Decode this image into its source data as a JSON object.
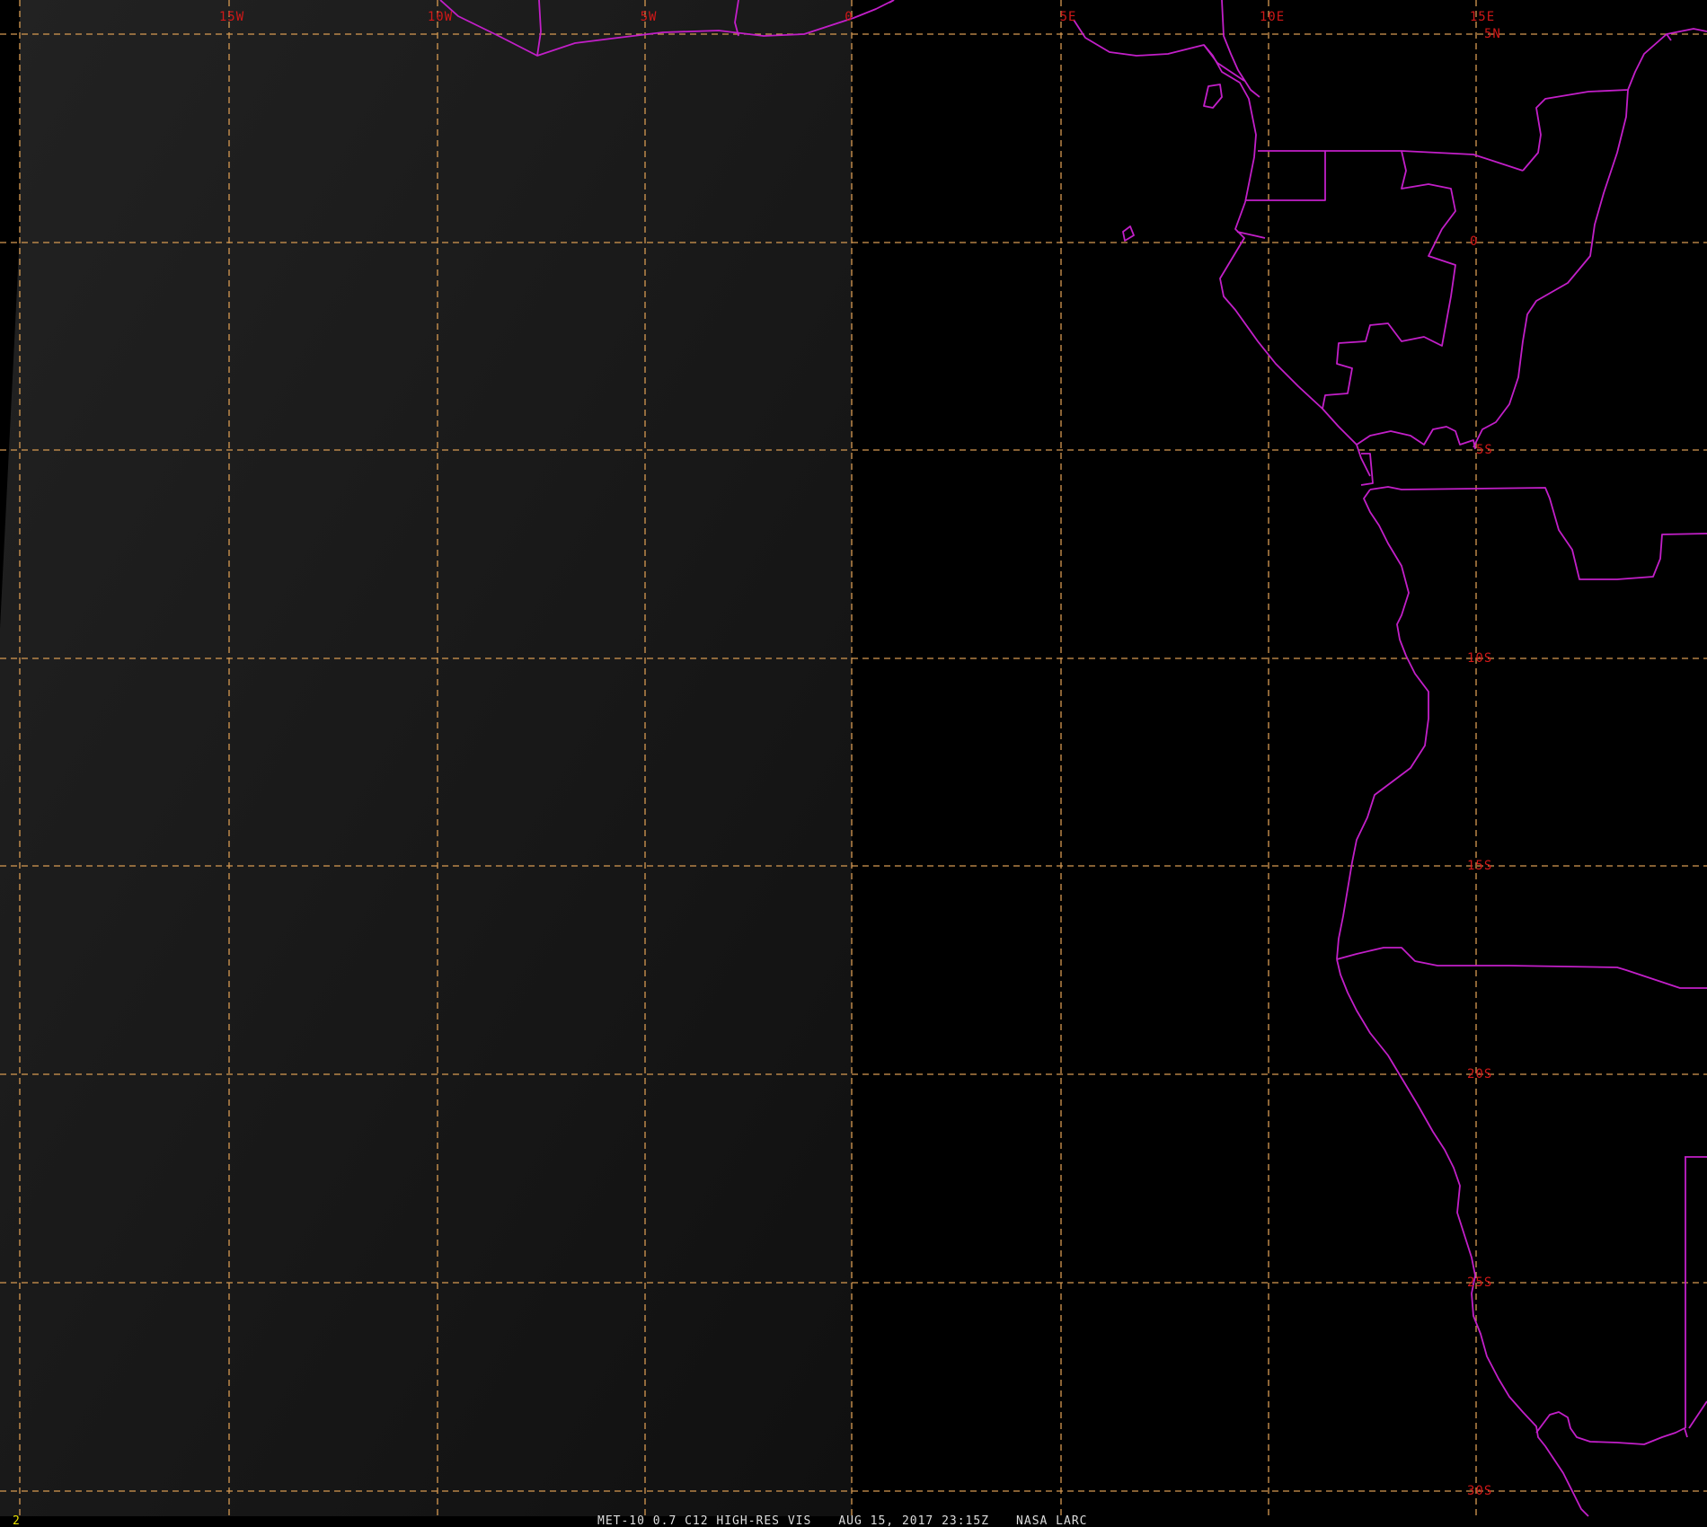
{
  "map": {
    "lon_labels": [
      "15W",
      "10W",
      "5W",
      "0",
      "5E",
      "10E",
      "15E"
    ],
    "lat_labels": [
      "5N",
      "0",
      "5S",
      "10S",
      "15S",
      "20S",
      "25S",
      "30S"
    ],
    "colors": {
      "background": "#000000",
      "daylit_region": "#1c1c1c",
      "graticule": "#d79a52",
      "grid_labels": "#d01818",
      "borders": "#c21fc8",
      "footer_text": "#dddddd",
      "frame_number": "#e8e000"
    }
  },
  "footer": {
    "frame_number": "2",
    "satellite_channel": "MET-10 0.7 C12 HIGH-RES VIS",
    "datetime": "AUG 15, 2017 23:15Z",
    "credit": "NASA LARC"
  }
}
